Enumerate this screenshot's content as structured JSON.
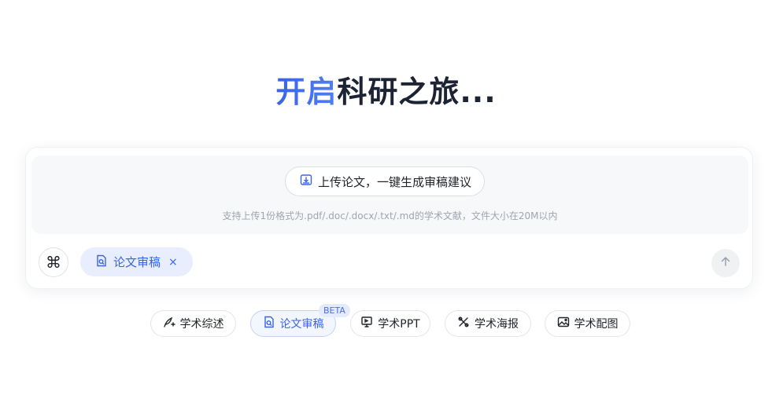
{
  "hero": {
    "title_highlight": "开启",
    "title_rest": "科研之旅..."
  },
  "composer": {
    "upload_label": "上传论文，一键生成审稿建议",
    "upload_hint": "支持上传1份格式为.pdf/.doc/.docx/.txt/.md的学术文献，文件大小在20M以内",
    "command_icon": "⌘",
    "mode_chip_label": "论文审稿",
    "mode_chip_close": "×"
  },
  "tools": [
    {
      "label": "学术综述",
      "icon": "pen-icon"
    },
    {
      "label": "论文审稿",
      "icon": "doc-search-icon",
      "badge": "BETA",
      "active": true
    },
    {
      "label": "学术PPT",
      "icon": "presentation-icon"
    },
    {
      "label": "学术海报",
      "icon": "poster-icon"
    },
    {
      "label": "学术配图",
      "icon": "image-icon"
    }
  ],
  "colors": {
    "accent": "#3a63e8",
    "chip_bg": "#e8eefd"
  }
}
